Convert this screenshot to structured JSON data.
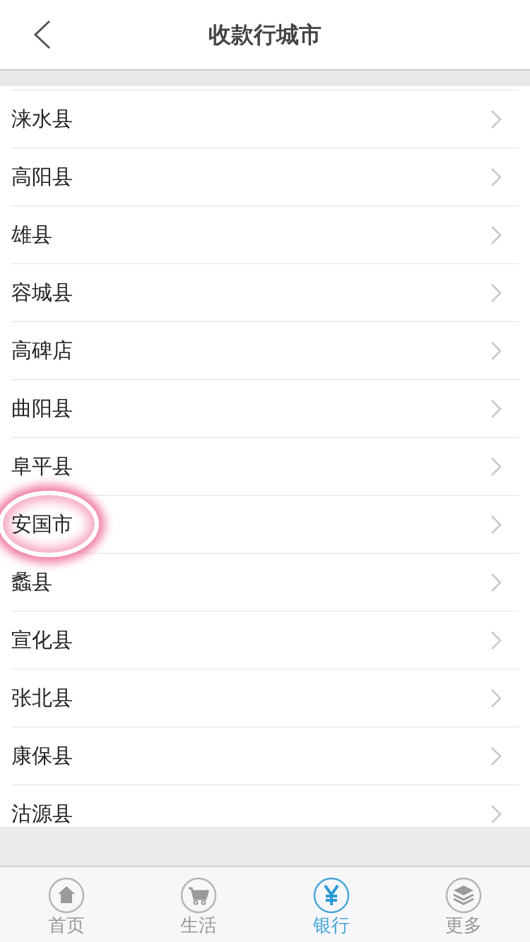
{
  "header": {
    "title": "收款行城市"
  },
  "cities": [
    {
      "name": "涞水县",
      "highlighted": false
    },
    {
      "name": "高阳县",
      "highlighted": false
    },
    {
      "name": "雄县",
      "highlighted": false
    },
    {
      "name": "容城县",
      "highlighted": false
    },
    {
      "name": "高碑店",
      "highlighted": false
    },
    {
      "name": "曲阳县",
      "highlighted": false
    },
    {
      "name": "阜平县",
      "highlighted": false
    },
    {
      "name": "安国市",
      "highlighted": true
    },
    {
      "name": "蠡县",
      "highlighted": false
    },
    {
      "name": "宣化县",
      "highlighted": false
    },
    {
      "name": "张北县",
      "highlighted": false
    },
    {
      "name": "康保县",
      "highlighted": false
    },
    {
      "name": "沽源县",
      "highlighted": false
    }
  ],
  "tabs": [
    {
      "label": "首页",
      "kind": "home",
      "selected": false
    },
    {
      "label": "生活",
      "kind": "cart",
      "selected": false
    },
    {
      "label": "银行",
      "kind": "yen",
      "selected": true
    },
    {
      "label": "更多",
      "kind": "layers",
      "selected": false
    }
  ]
}
